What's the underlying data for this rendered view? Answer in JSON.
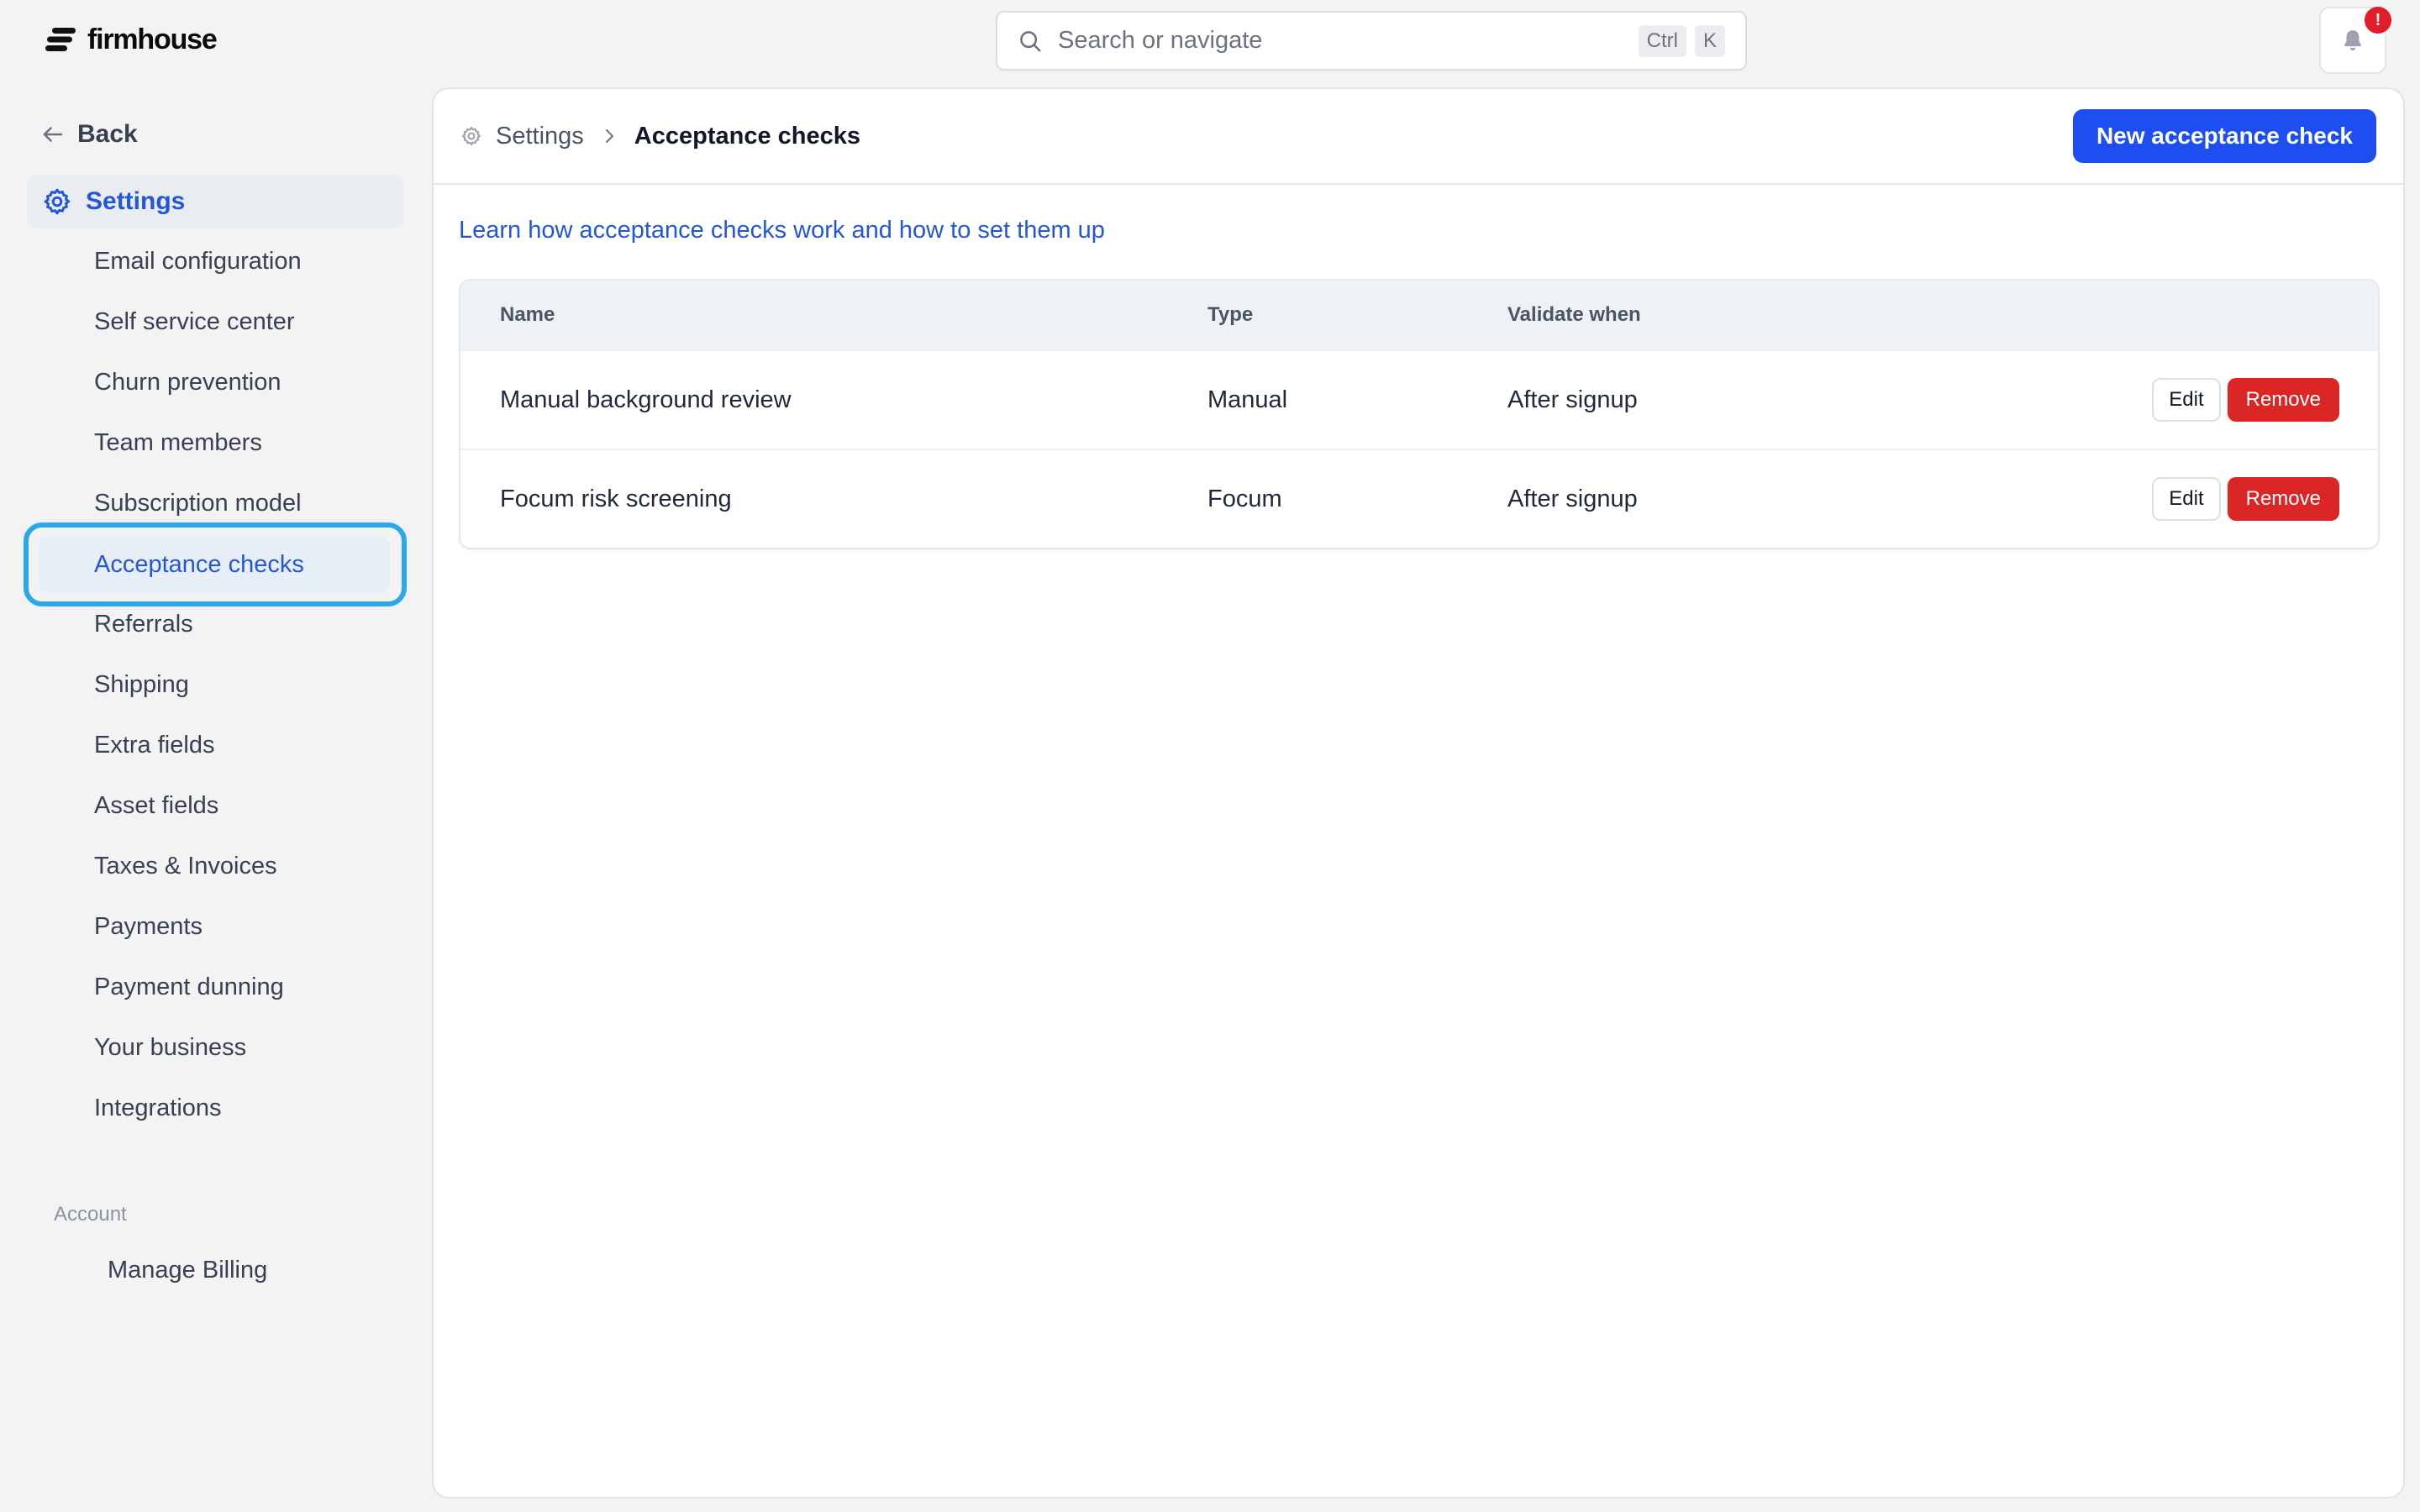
{
  "app": {
    "brand": "firmhouse",
    "accent_color": "#1d4ff0",
    "danger_color": "#dc2626",
    "highlight_color": "#2aa8ea"
  },
  "topbar": {
    "search_placeholder": "Search or navigate",
    "shortcut_key_1": "Ctrl",
    "shortcut_key_2": "K",
    "notification_badge": "!"
  },
  "sidebar": {
    "back_label": "Back",
    "section_label": "Settings",
    "items": [
      {
        "label": "Email configuration"
      },
      {
        "label": "Self service center"
      },
      {
        "label": "Churn prevention"
      },
      {
        "label": "Team members"
      },
      {
        "label": "Subscription model"
      },
      {
        "label": "Acceptance checks"
      },
      {
        "label": "Referrals"
      },
      {
        "label": "Shipping"
      },
      {
        "label": "Extra fields"
      },
      {
        "label": "Asset fields"
      },
      {
        "label": "Taxes & Invoices"
      },
      {
        "label": "Payments"
      },
      {
        "label": "Payment dunning"
      },
      {
        "label": "Your business"
      },
      {
        "label": "Integrations"
      }
    ],
    "active_item": "Acceptance checks",
    "account_label": "Account",
    "billing_label": "Manage Billing"
  },
  "main": {
    "breadcrumb_root": "Settings",
    "breadcrumb_current": "Acceptance checks",
    "new_button_label": "New acceptance check",
    "learn_link": "Learn how acceptance checks work and how to set them up",
    "table": {
      "headers": [
        "Name",
        "Type",
        "Validate when"
      ],
      "rows": [
        {
          "name": "Manual background review",
          "type": "Manual",
          "validate_when": "After signup",
          "edit_label": "Edit",
          "remove_label": "Remove"
        },
        {
          "name": "Focum risk screening",
          "type": "Focum",
          "validate_when": "After signup",
          "edit_label": "Edit",
          "remove_label": "Remove"
        }
      ]
    }
  }
}
